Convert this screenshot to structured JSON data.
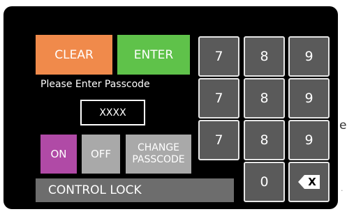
{
  "buttons": {
    "clear": "CLEAR",
    "enter": "ENTER",
    "on": "ON",
    "off": "OFF",
    "change_line1": "CHANGE",
    "change_line2": "PASSCODE"
  },
  "prompt": "Please Enter Passcode",
  "passcode_value": "XXXX",
  "title": "CONTROL LOCK",
  "keypad": {
    "rows": [
      [
        "7",
        "8",
        "9"
      ],
      [
        "7",
        "8",
        "9"
      ],
      [
        "7",
        "8",
        "9"
      ]
    ],
    "zero": "0",
    "backspace_label": "X"
  },
  "edge_text": {
    "char1": "e",
    "char2": "."
  },
  "colors": {
    "clear": "#f08a4b",
    "enter": "#5fc24a",
    "on": "#b04aa6",
    "off": "#a9a9a9",
    "title_bar": "#6d6d6d",
    "key": "#5a5a5a"
  }
}
